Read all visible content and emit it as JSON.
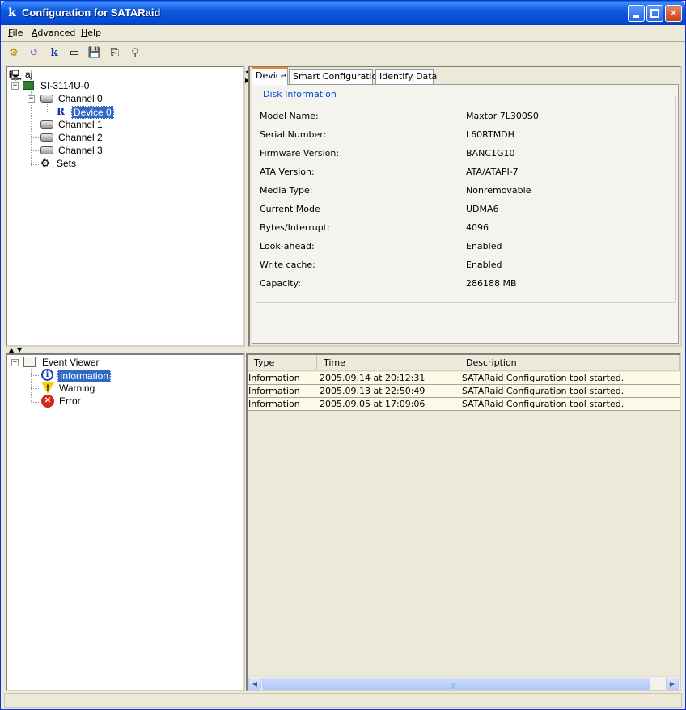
{
  "window": {
    "title": "Configuration for SATARaid",
    "app_icon": "k",
    "controls": {
      "minimize": "",
      "maximize": "",
      "close": "✕"
    }
  },
  "menu": {
    "items": [
      {
        "key": "F",
        "rest": "ile"
      },
      {
        "key": "A",
        "rest": "dvanced"
      },
      {
        "key": "H",
        "rest": "elp"
      }
    ]
  },
  "toolbar": {
    "icons": [
      "gear-icon",
      "refresh-icon",
      "wizard-icon",
      "drive-icon",
      "save-icon",
      "copy-icon",
      "binoculars-icon"
    ],
    "glyphs": [
      "⚙",
      "↺",
      "k",
      "▭",
      "💾",
      "⎘",
      "⚲"
    ]
  },
  "device_tree": {
    "root": "aj",
    "controller": "SI-3114U-0",
    "channel0": "Channel 0",
    "device0": "Device 0",
    "device0_glyph": "R",
    "channel1": "Channel 1",
    "channel2": "Channel 2",
    "channel3": "Channel 3",
    "sets": "Sets"
  },
  "tabs": {
    "device": "Device",
    "smart": "Smart Configuration",
    "identify": "Identify Data"
  },
  "disk_info": {
    "title": "Disk Information",
    "fields": [
      {
        "label": "Model Name:",
        "value": "Maxtor 7L300S0"
      },
      {
        "label": "Serial Number:",
        "value": "L60RTMDH"
      },
      {
        "label": "Firmware Version:",
        "value": "BANC1G10"
      },
      {
        "label": "ATA Version:",
        "value": "ATA/ATAPI-7"
      },
      {
        "label": "Media Type:",
        "value": "Nonremovable"
      },
      {
        "label": "Current Mode",
        "value": "UDMA6"
      },
      {
        "label": "Bytes/Interrupt:",
        "value": "4096"
      },
      {
        "label": "Look-ahead:",
        "value": "Enabled"
      },
      {
        "label": "Write cache:",
        "value": "Enabled"
      },
      {
        "label": "Capacity:",
        "value": "286188 MB"
      }
    ]
  },
  "event_tree": {
    "root": "Event Viewer",
    "information": "Information",
    "warning": "Warning",
    "error": "Error",
    "info_glyph": "i",
    "warn_glyph": "!",
    "error_glyph": "✕"
  },
  "event_table": {
    "columns": [
      "Type",
      "Time",
      "Description"
    ],
    "rows": [
      {
        "type": "Information",
        "time": "2005.09.14 at 20:12:31",
        "desc": "SATARaid Configuration tool started."
      },
      {
        "type": "Information",
        "time": "2005.09.13 at 22:50:49",
        "desc": "SATARaid Configuration tool started."
      },
      {
        "type": "Information",
        "time": "2005.09.05 at 17:09:06",
        "desc": "SATARaid Configuration tool started."
      }
    ],
    "scroll_left": "◀",
    "scroll_right": "▶",
    "grip": "|||"
  },
  "splitter": {
    "up": "▲",
    "down": "▼",
    "left": "◀",
    "right": "▶"
  },
  "colors": {
    "title_bar": "#0549d3",
    "selection": "#316ac5",
    "tab_accent": "#e68b2c",
    "groupbox_title": "#0046d5"
  }
}
